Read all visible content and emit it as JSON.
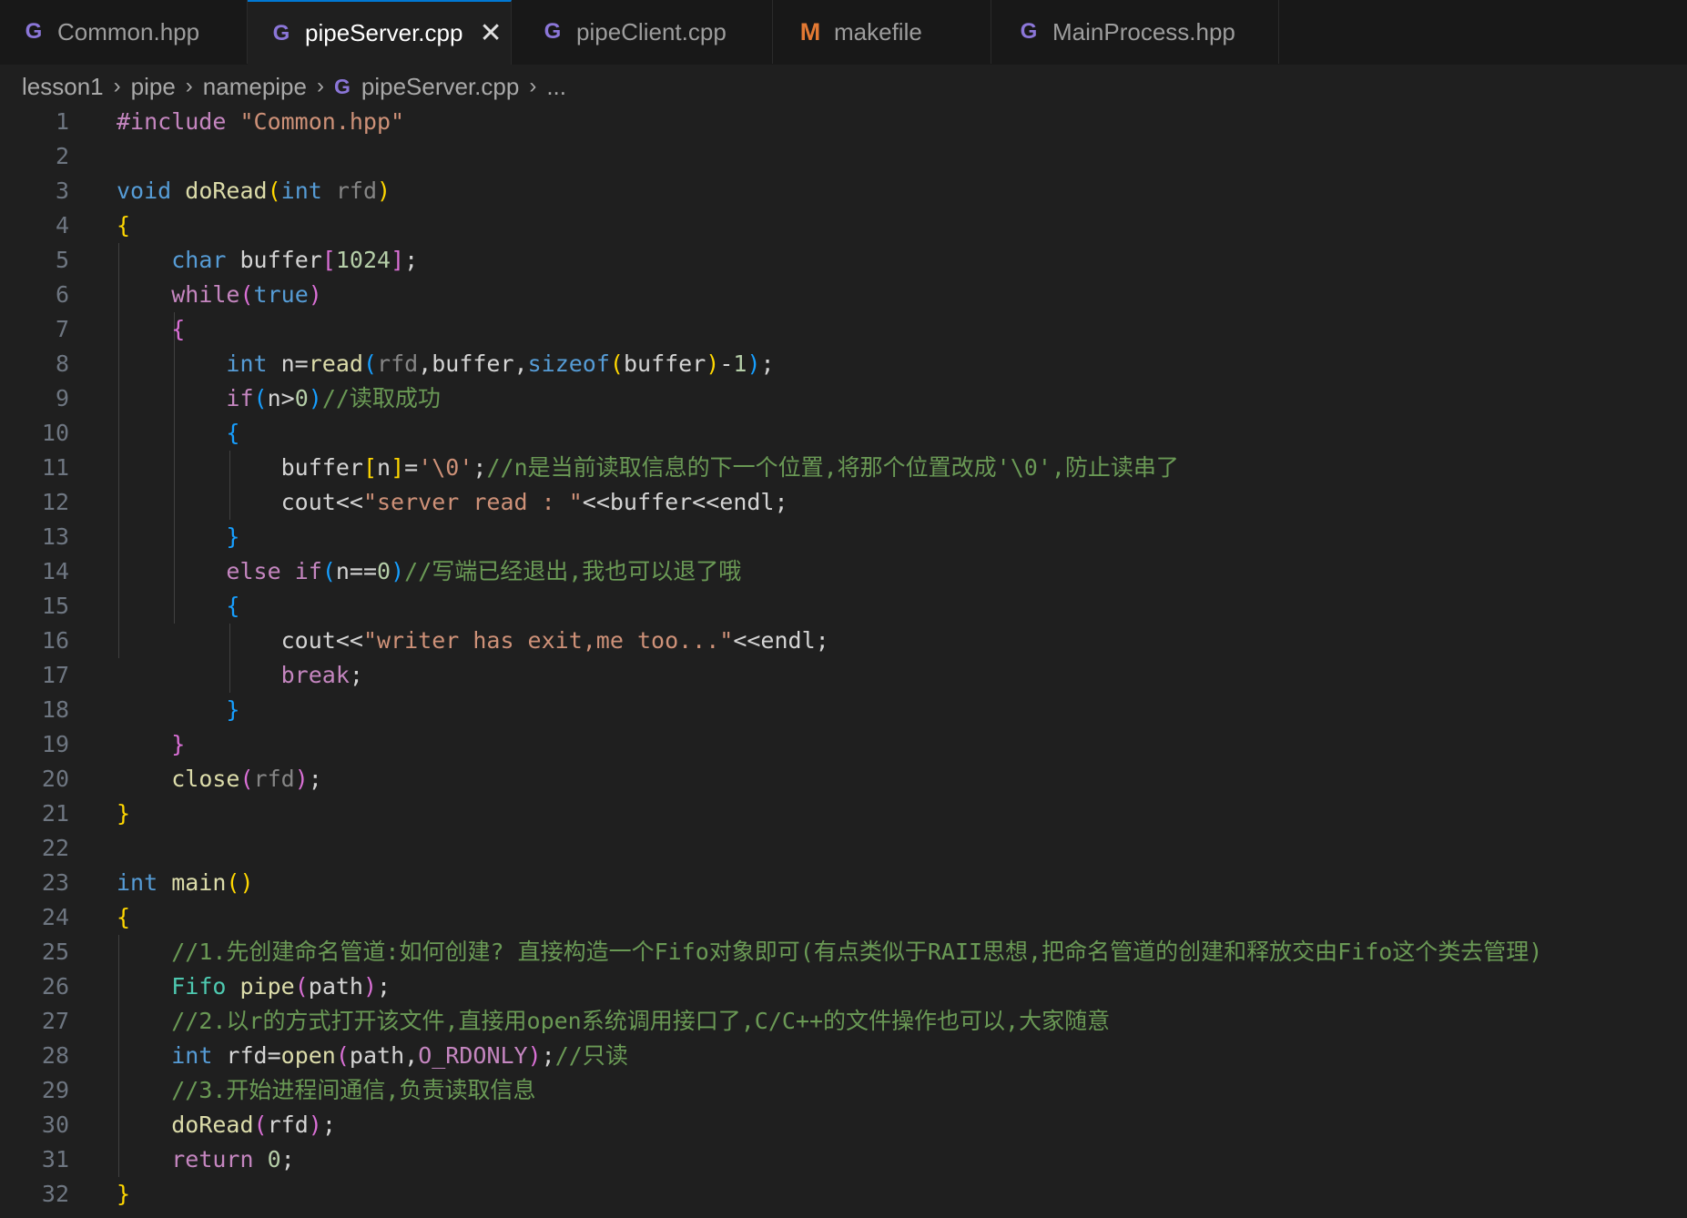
{
  "tabs": [
    {
      "label": "Common.hpp",
      "icon": "cpp-icon"
    },
    {
      "label": "pipeServer.cpp",
      "icon": "cpp-icon",
      "active": true
    },
    {
      "label": "pipeClient.cpp",
      "icon": "cpp-icon"
    },
    {
      "label": "makefile",
      "icon": "makefile-icon"
    },
    {
      "label": "MainProcess.hpp",
      "icon": "cpp-icon"
    }
  ],
  "breadcrumb": [
    "lesson1",
    "pipe",
    "namepipe",
    "pipeServer.cpp",
    "..."
  ],
  "colors": {
    "keyword": "#569cd6",
    "control": "#c586c0",
    "string": "#ce9178",
    "comment": "#6a9955",
    "number": "#b5cea8"
  },
  "editor": {
    "lines": [
      [
        [
          "#include ",
          "mac"
        ],
        [
          "\"Common.hpp\"",
          "str"
        ]
      ],
      [],
      [
        [
          "void",
          "kw"
        ],
        [
          " doRead",
          "fn"
        ],
        [
          "(",
          "b1"
        ],
        [
          "int",
          "kw"
        ],
        [
          " ",
          "pn"
        ],
        [
          "rfd",
          "par"
        ],
        [
          ")",
          "b1"
        ]
      ],
      [
        [
          "{",
          "b1"
        ]
      ],
      [
        [
          "    ",
          "pn"
        ],
        [
          "char",
          "kw"
        ],
        [
          " buffer",
          "pn"
        ],
        [
          "[",
          "b2"
        ],
        [
          "1024",
          "num"
        ],
        [
          "]",
          "b2"
        ],
        [
          ";",
          "pn"
        ]
      ],
      [
        [
          "    ",
          "pn"
        ],
        [
          "while",
          "ctl"
        ],
        [
          "(",
          "b2"
        ],
        [
          "true",
          "kw"
        ],
        [
          ")",
          "b2"
        ]
      ],
      [
        [
          "    ",
          "pn"
        ],
        [
          "{",
          "b2"
        ]
      ],
      [
        [
          "        ",
          "pn"
        ],
        [
          "int",
          "kw"
        ],
        [
          " n=",
          "pn"
        ],
        [
          "read",
          "fn"
        ],
        [
          "(",
          "b3"
        ],
        [
          "rfd",
          "par"
        ],
        [
          ",buffer,",
          "pn"
        ],
        [
          "sizeof",
          "kw"
        ],
        [
          "(",
          "b1"
        ],
        [
          "buffer",
          "pn"
        ],
        [
          ")",
          "b1"
        ],
        [
          "-",
          "pn"
        ],
        [
          "1",
          "num"
        ],
        [
          ")",
          "b3"
        ],
        [
          ";",
          "pn"
        ]
      ],
      [
        [
          "        ",
          "pn"
        ],
        [
          "if",
          "ctl"
        ],
        [
          "(",
          "b3"
        ],
        [
          "n>",
          "pn"
        ],
        [
          "0",
          "num"
        ],
        [
          ")",
          "b3"
        ],
        [
          "//读取成功",
          "cm"
        ]
      ],
      [
        [
          "        ",
          "pn"
        ],
        [
          "{",
          "b3"
        ]
      ],
      [
        [
          "            ",
          "pn"
        ],
        [
          "buffer",
          "pn"
        ],
        [
          "[",
          "b1"
        ],
        [
          "n",
          "pn"
        ],
        [
          "]",
          "b1"
        ],
        [
          "=",
          "pn"
        ],
        [
          "'\\0'",
          "str"
        ],
        [
          ";",
          "pn"
        ],
        [
          "//n是当前读取信息的下一个位置,将那个位置改成'\\0',防止读串了",
          "cm"
        ]
      ],
      [
        [
          "            ",
          "pn"
        ],
        [
          "cout<<",
          "pn"
        ],
        [
          "\"server read : \"",
          "str"
        ],
        [
          "<<buffer<<endl;",
          "pn"
        ]
      ],
      [
        [
          "        ",
          "pn"
        ],
        [
          "}",
          "b3"
        ]
      ],
      [
        [
          "        ",
          "pn"
        ],
        [
          "else",
          "ctl"
        ],
        [
          " ",
          "pn"
        ],
        [
          "if",
          "ctl"
        ],
        [
          "(",
          "b3"
        ],
        [
          "n==",
          "pn"
        ],
        [
          "0",
          "num"
        ],
        [
          ")",
          "b3"
        ],
        [
          "//写端已经退出,我也可以退了哦",
          "cm"
        ]
      ],
      [
        [
          "        ",
          "pn"
        ],
        [
          "{",
          "b3"
        ]
      ],
      [
        [
          "            ",
          "pn"
        ],
        [
          "cout<<",
          "pn"
        ],
        [
          "\"writer has exit,me too...\"",
          "str"
        ],
        [
          "<<endl;",
          "pn"
        ]
      ],
      [
        [
          "            ",
          "pn"
        ],
        [
          "break",
          "ctl"
        ],
        [
          ";",
          "pn"
        ]
      ],
      [
        [
          "        ",
          "pn"
        ],
        [
          "}",
          "b3"
        ]
      ],
      [
        [
          "    ",
          "pn"
        ],
        [
          "}",
          "b2"
        ]
      ],
      [
        [
          "    ",
          "pn"
        ],
        [
          "close",
          "fn"
        ],
        [
          "(",
          "b2"
        ],
        [
          "rfd",
          "par"
        ],
        [
          ")",
          "b2"
        ],
        [
          ";",
          "pn"
        ]
      ],
      [
        [
          "}",
          "b1"
        ]
      ],
      [],
      [
        [
          "int",
          "kw"
        ],
        [
          " main",
          "fn"
        ],
        [
          "()",
          "b1"
        ]
      ],
      [
        [
          "{",
          "b1"
        ]
      ],
      [
        [
          "    ",
          "pn"
        ],
        [
          "//1.先创建命名管道:如何创建? 直接构造一个Fifo对象即可(有点类似于RAII思想,把命名管道的创建和释放交由Fifo这个类去管理)",
          "cm"
        ]
      ],
      [
        [
          "    ",
          "pn"
        ],
        [
          "Fifo",
          "typ"
        ],
        [
          " pipe",
          "fn"
        ],
        [
          "(",
          "b2"
        ],
        [
          "path",
          "pn"
        ],
        [
          ")",
          "b2"
        ],
        [
          ";",
          "pn"
        ]
      ],
      [
        [
          "    ",
          "pn"
        ],
        [
          "//2.以r的方式打开该文件,直接用open系统调用接口了,C/C++的文件操作也可以,大家随意",
          "cm"
        ]
      ],
      [
        [
          "    ",
          "pn"
        ],
        [
          "int",
          "kw"
        ],
        [
          " rfd=",
          "pn"
        ],
        [
          "open",
          "fn"
        ],
        [
          "(",
          "b2"
        ],
        [
          "path,",
          "pn"
        ],
        [
          "O_RDONLY",
          "mac"
        ],
        [
          ")",
          "b2"
        ],
        [
          ";",
          "pn"
        ],
        [
          "//只读",
          "cm"
        ]
      ],
      [
        [
          "    ",
          "pn"
        ],
        [
          "//3.开始进程间通信,负责读取信息",
          "cm"
        ]
      ],
      [
        [
          "    ",
          "pn"
        ],
        [
          "doRead",
          "fn"
        ],
        [
          "(",
          "b2"
        ],
        [
          "rfd",
          "pn"
        ],
        [
          ")",
          "b2"
        ],
        [
          ";",
          "pn"
        ]
      ],
      [
        [
          "    ",
          "pn"
        ],
        [
          "return",
          "ctl"
        ],
        [
          " ",
          "pn"
        ],
        [
          "0",
          "num"
        ],
        [
          ";",
          "pn"
        ]
      ],
      [
        [
          "}",
          "b1"
        ]
      ]
    ]
  }
}
